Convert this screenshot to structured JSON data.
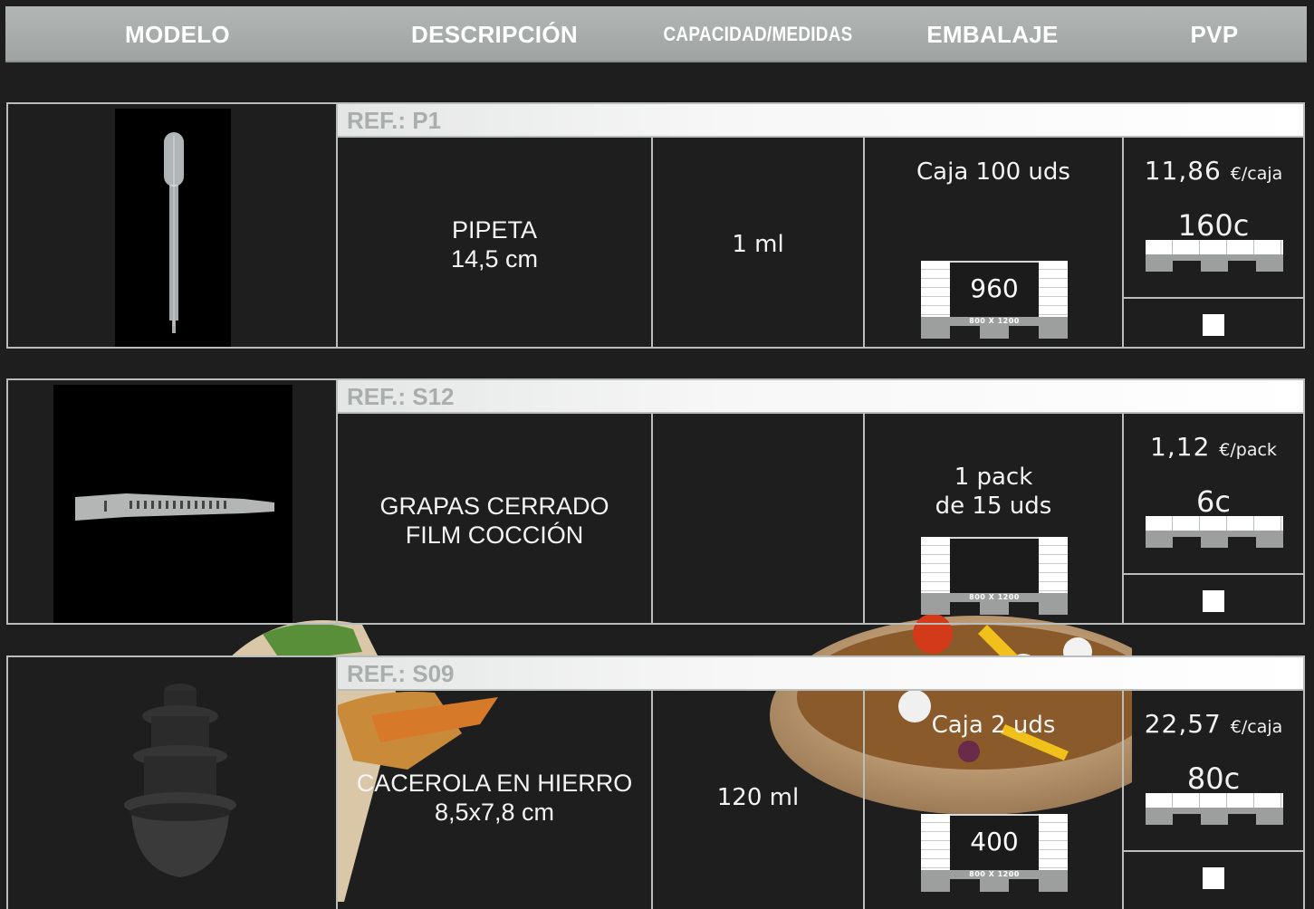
{
  "header": {
    "modelo": "MODELO",
    "descripcion": "DESCRIPCIÓN",
    "capacidad": "CAPACIDAD/MEDIDAS",
    "embalaje": "EMBALAJE",
    "pvp": "PVP"
  },
  "pallet_label": "800 X 1200",
  "products": [
    {
      "ref": "REF.: P1",
      "descripcion": "PIPETA\n14,5 cm",
      "capacidad": "1 ml",
      "embalaje": "Caja 100 uds",
      "pallet_qty": "960",
      "price": "11,86",
      "price_unit": "€/caja",
      "min_order": "160c"
    },
    {
      "ref": "REF.: S12",
      "descripcion": "GRAPAS CERRADO\nFILM COCCIÓN",
      "capacidad": "",
      "embalaje": "1 pack\nde 15 uds",
      "pallet_qty": "",
      "price": "1,12",
      "price_unit": "€/pack",
      "min_order": "6c"
    },
    {
      "ref": "REF.: S09",
      "descripcion": "CACEROLA EN HIERRO\n8,5x7,8 cm",
      "capacidad": "120 ml",
      "embalaje": "Caja 2 uds",
      "pallet_qty": "400",
      "price": "22,57",
      "price_unit": "€/caja",
      "min_order": "80c"
    }
  ]
}
